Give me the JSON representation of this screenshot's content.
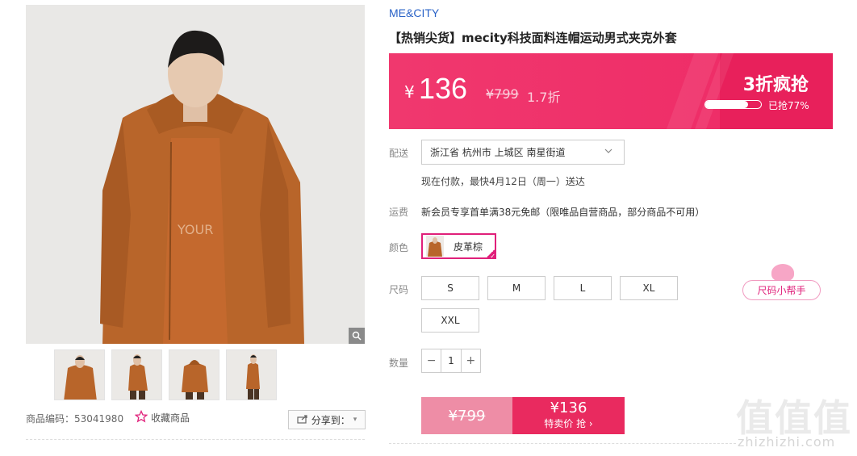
{
  "product": {
    "brand": "ME&CITY",
    "title": "【热销尖货】mecity科技面料连帽运动男式夹克外套",
    "code_label": "商品编码：53041980",
    "favorite_label": "收藏商品",
    "share_label": "分享到："
  },
  "price": {
    "currency": "¥",
    "current": "136",
    "original": "¥799",
    "discount": "1.7折",
    "promo_title": "3折疯抢",
    "sold_progress": 0.77,
    "sold_text": "已抢77%"
  },
  "delivery": {
    "label": "配送",
    "address": "浙江省 杭州市 上城区 南星街道",
    "note": "现在付款，最快4月12日（周一）送达"
  },
  "shipping": {
    "label": "运费",
    "text": "新会员专享首单满38元免邮（限唯品自营商品，部分商品不可用）"
  },
  "color": {
    "label": "颜色",
    "selected": "皮革棕"
  },
  "size": {
    "label": "尺码",
    "options": [
      "S",
      "M",
      "L",
      "XL",
      "XXL"
    ],
    "helper_label": "尺码小帮手"
  },
  "quantity": {
    "label": "数量",
    "minus": "−",
    "value": "1",
    "plus": "+"
  },
  "buy": {
    "original": "¥799",
    "price": "¥136",
    "action": "特卖价 抢 ›"
  },
  "watermark": {
    "big": "值值值",
    "small": "zhizhizhi.com"
  },
  "colors": {
    "accent": "#e92a5f",
    "brand_link": "#2a63c7",
    "jacket": "#b8652a"
  }
}
